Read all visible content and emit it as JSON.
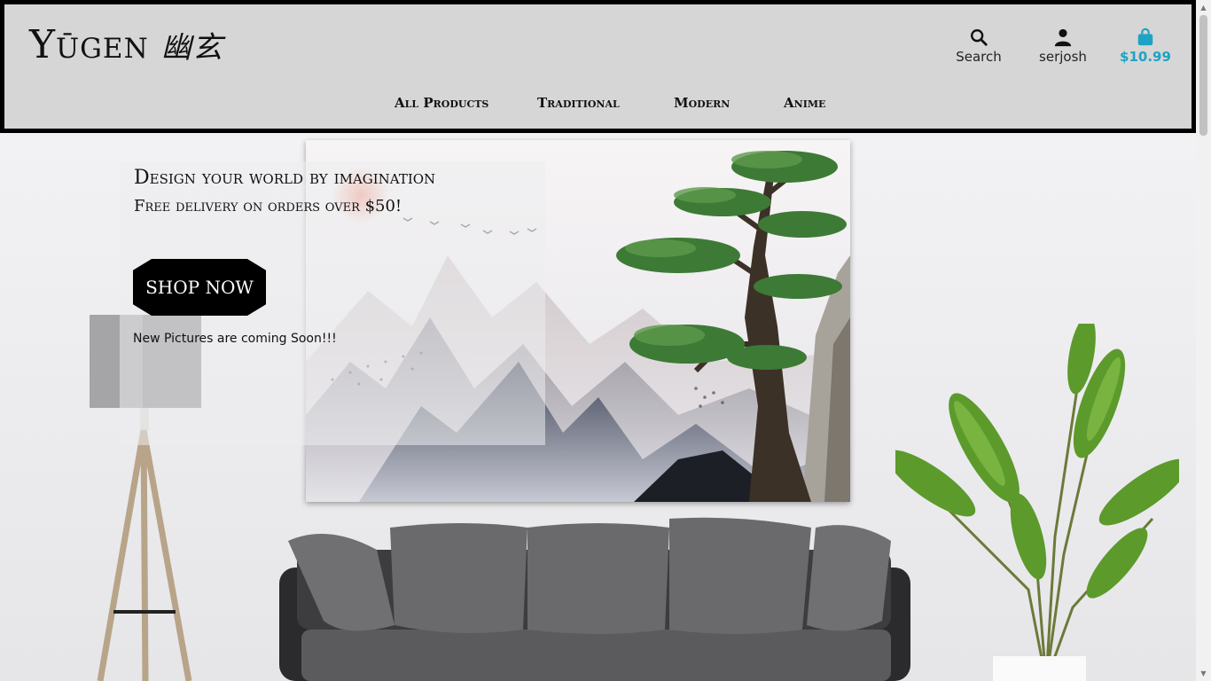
{
  "brand": {
    "name": "Yūgen",
    "kanji": "幽玄"
  },
  "header_actions": {
    "search_label": "Search",
    "user_label": "serjosh",
    "cart_total": "$10.99"
  },
  "nav": [
    "All Products",
    "Traditional",
    "Modern",
    "Anime"
  ],
  "hero": {
    "title": "Design your world by imagination",
    "subtitle": "Free delivery on orders over $50!",
    "cta_label": "SHOP NOW",
    "note": "New Pictures are coming Soon!!!"
  },
  "colors": {
    "accent": "#1fa3c4",
    "header_bg": "#d6d6d6",
    "border": "#000000"
  }
}
